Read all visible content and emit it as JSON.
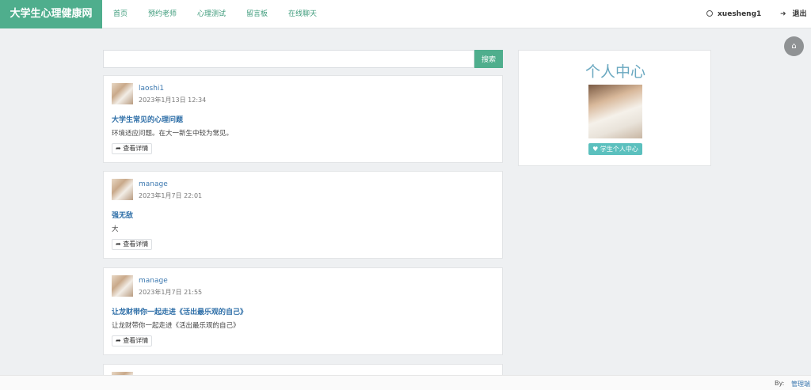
{
  "brand": "大学生心理健康网",
  "nav": [
    "首页",
    "预约老师",
    "心理测试",
    "留言板",
    "在线聊天"
  ],
  "user": {
    "name": "xuesheng1",
    "logout": "退出"
  },
  "search": {
    "placeholder": "",
    "button": "搜索"
  },
  "posts": [
    {
      "author": "laoshi1",
      "time": "2023年1月13日 12:34",
      "title": "大学生常见的心理问题",
      "excerpt": "环境适应问题。在大一新生中较为常见。",
      "detail": "查看详情"
    },
    {
      "author": "manage",
      "time": "2023年1月7日 22:01",
      "title": "强无敌",
      "excerpt": "大",
      "detail": "查看详情"
    },
    {
      "author": "manage",
      "time": "2023年1月7日 21:55",
      "title": "让龙财带你一起走进《活出最乐观的自己》",
      "excerpt": "让龙财带你一起走进《活出最乐观的自己》",
      "detail": "查看详情"
    }
  ],
  "sidebar": {
    "title": "个人中心",
    "button": "学生个人中心"
  },
  "footer": {
    "by": "By:",
    "link": "管理端"
  },
  "colors": {
    "accent": "#4fae8d",
    "link": "#3d79b0",
    "badge": "#5bc0be"
  },
  "icons": {
    "user": "user-circle-icon",
    "logout": "sign-out-icon",
    "home": "home-icon",
    "share": "share-arrow-icon",
    "heart": "heart-icon"
  }
}
